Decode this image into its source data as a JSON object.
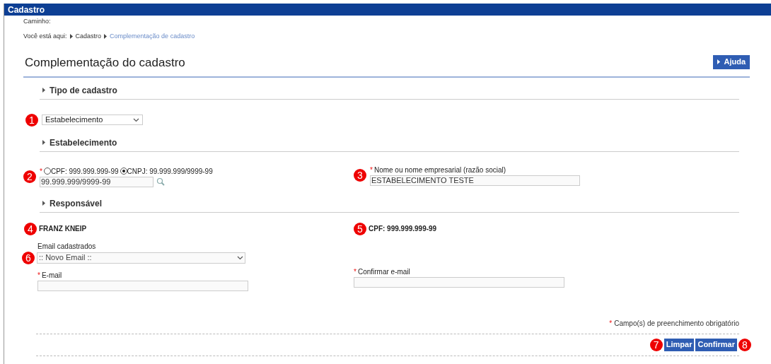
{
  "header": {
    "title": "Cadastro"
  },
  "breadcrumb": {
    "label": "Caminho:",
    "prefix": "Você está aqui:",
    "items": [
      {
        "text": "Cadastro",
        "current": false
      },
      {
        "text": "Complementação de cadastro",
        "current": true
      }
    ]
  },
  "page_title": "Complementação do cadastro",
  "help_button": "Ajuda",
  "tipo_section": {
    "title": "Tipo de cadastro",
    "select": {
      "value": "Estabelecimento",
      "callout": "1"
    }
  },
  "estabelecimento_section": {
    "title": "Estabelecimento",
    "document": {
      "callout": "2",
      "required_mark": "*",
      "options": [
        {
          "label": "CPF: 999.999.999-99",
          "selected": false
        },
        {
          "label": "CNPJ: 99.999.999/9999-99",
          "selected": true
        }
      ],
      "value": "99.999.999/9999-99"
    },
    "name": {
      "callout": "3",
      "required_mark": "*",
      "label": "Nome ou nome empresarial (razão social)",
      "value": "ESTABELECIMENTO TESTE"
    }
  },
  "responsavel_section": {
    "title": "Responsável",
    "name": {
      "callout": "4",
      "text": "FRANZ KNEIP"
    },
    "cpf": {
      "callout": "5",
      "text": "CPF: 999.999.999-99"
    },
    "emails": {
      "callout": "6",
      "label": "Email cadastrados",
      "value": ":: Novo Email ::"
    },
    "email": {
      "required_mark": "*",
      "label": "E-mail"
    },
    "confirm_email": {
      "required_mark": "*",
      "label": "Confirmar e-mail"
    }
  },
  "required_note": {
    "mark": "*",
    "text": "Campo(s) de preenchimento obrigatório"
  },
  "buttons": [
    {
      "label": "Limpar",
      "callout_before": "7"
    },
    {
      "label": "Confirmar",
      "callout_after": "8"
    }
  ]
}
